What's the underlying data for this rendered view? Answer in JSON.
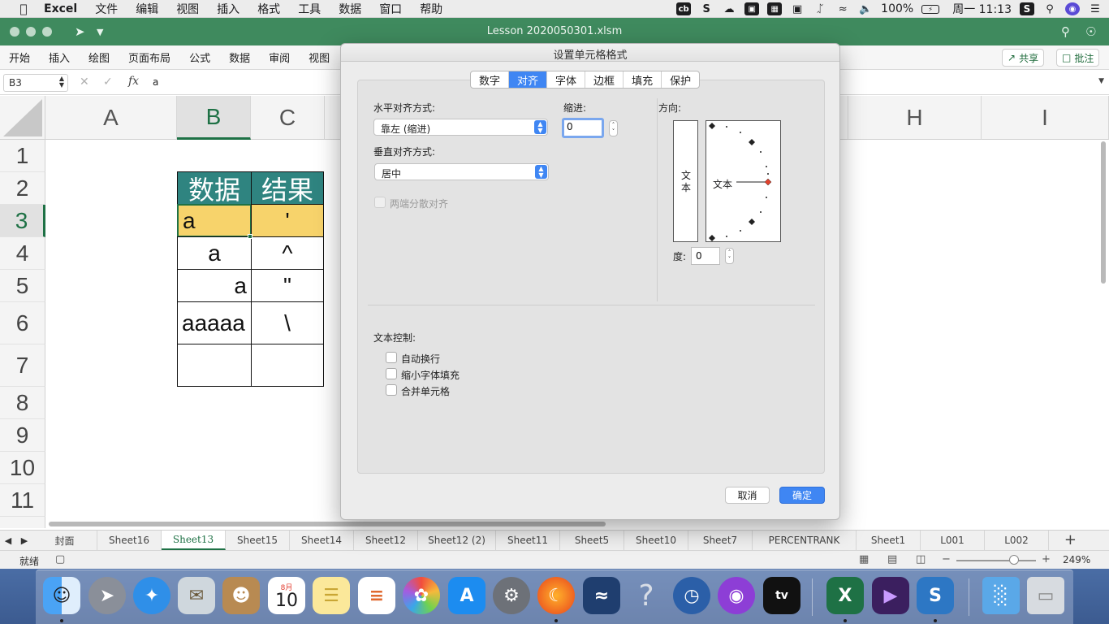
{
  "menubar": {
    "apple": "",
    "app_name": "Excel",
    "items": [
      "文件",
      "编辑",
      "视图",
      "插入",
      "格式",
      "工具",
      "数据",
      "窗口",
      "帮助"
    ],
    "battery": "100%",
    "clock": "周一 11:13"
  },
  "window": {
    "title": "Lesson 2020050301.xlsm"
  },
  "ribbon": {
    "tabs": [
      "开始",
      "插入",
      "绘图",
      "页面布局",
      "公式",
      "数据",
      "审阅",
      "视图"
    ],
    "share_label": "共享",
    "comment_label": "批注"
  },
  "formula_bar": {
    "name_box": "B3",
    "fx": "fx",
    "value": "a"
  },
  "grid": {
    "columns": [
      "A",
      "B",
      "C",
      "H",
      "I"
    ],
    "rows": [
      "1",
      "2",
      "3",
      "4",
      "5",
      "6",
      "7",
      "8",
      "9",
      "10",
      "11"
    ],
    "table_header": [
      "数据",
      "结果"
    ],
    "table_rows": [
      [
        "a",
        "'"
      ],
      [
        "a",
        "^"
      ],
      [
        "a",
        "\""
      ],
      [
        "aaaaa",
        "\\"
      ],
      [
        "",
        ""
      ]
    ]
  },
  "sheet_tabs": [
    "封面",
    "Sheet16",
    "Sheet13",
    "Sheet15",
    "Sheet14",
    "Sheet12",
    "Sheet12 (2)",
    "Sheet11",
    "Sheet5",
    "Sheet10",
    "Sheet7",
    "PERCENTRANK",
    "Sheet1",
    "L001",
    "L002"
  ],
  "active_sheet": "Sheet13",
  "status": {
    "ready": "就绪",
    "zoom": "249%"
  },
  "dialog": {
    "title": "设置单元格格式",
    "tabs": [
      "数字",
      "对齐",
      "字体",
      "边框",
      "填充",
      "保护"
    ],
    "active_tab": "对齐",
    "horizontal_label": "水平对齐方式:",
    "horizontal_value": "靠左 (缩进)",
    "indent_label": "缩进:",
    "indent_value": "0",
    "vertical_label": "垂直对齐方式:",
    "vertical_value": "居中",
    "justify_distributed": "两端分散对齐",
    "orientation_label": "方向:",
    "orientation_text": "文本",
    "vertical_text_chars": [
      "文",
      "本"
    ],
    "degree_label": "度:",
    "degree_value": "0",
    "text_control_label": "文本控制:",
    "wrap_text": "自动换行",
    "shrink_to_fit": "缩小字体填充",
    "merge_cells": "合并单元格",
    "cancel": "取消",
    "ok": "确定"
  },
  "dock": {
    "calendar_month": "8月",
    "calendar_day": "10",
    "help_glyph": "?"
  },
  "colors": {
    "excel_green": "#3f8a5e",
    "table_header": "#2f8480",
    "selected_cell": "#f7d36b",
    "mac_blue": "#3f86f3"
  }
}
